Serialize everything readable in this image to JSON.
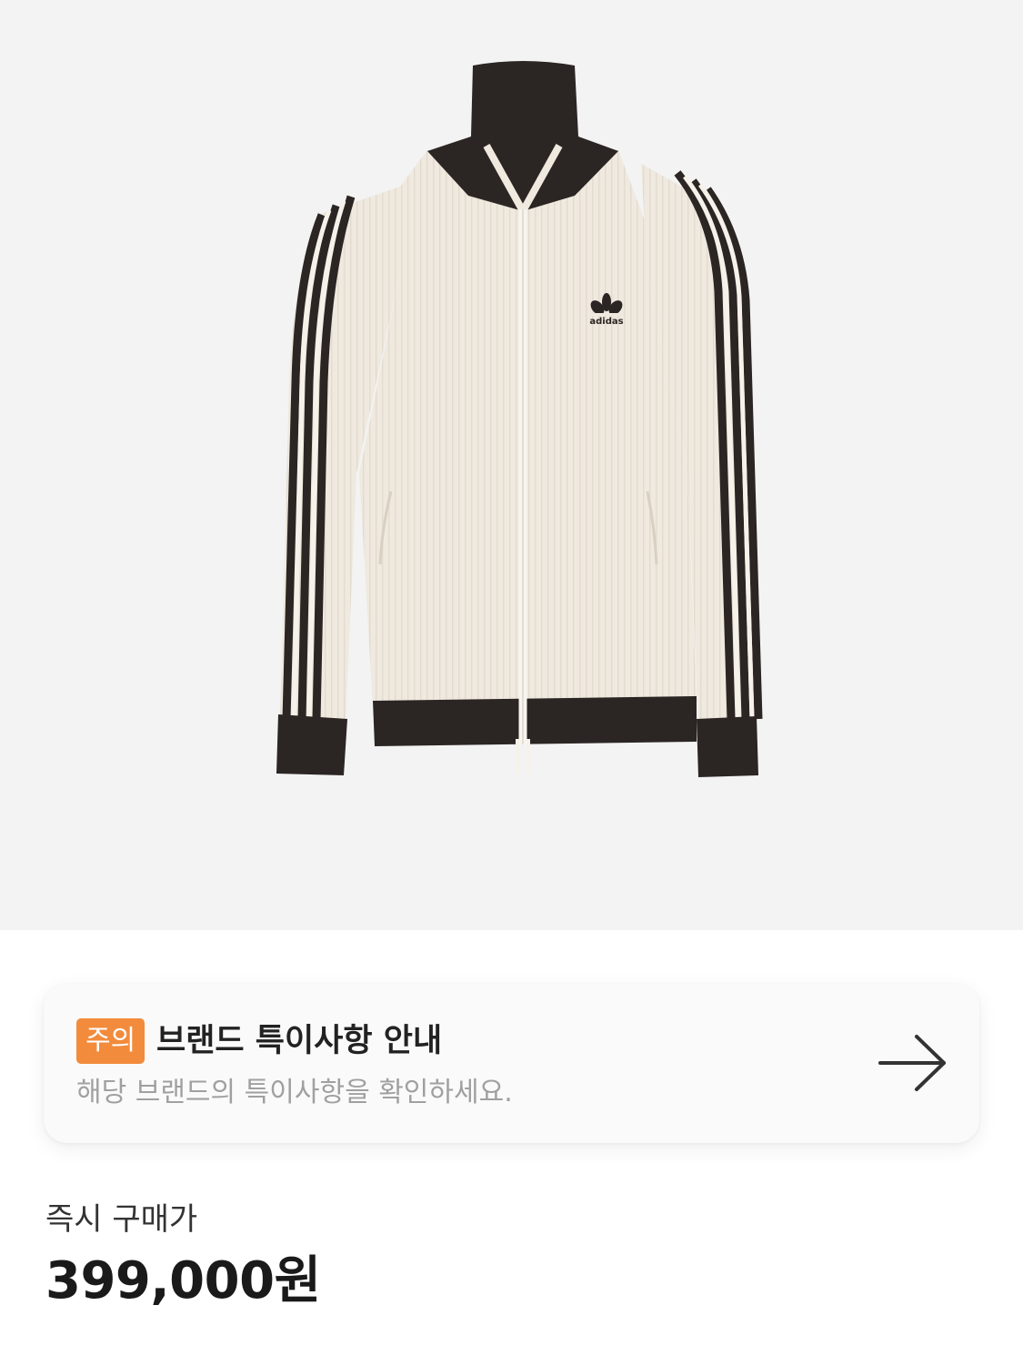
{
  "product": {
    "image_alt": "adidas track jacket",
    "logo_text": "adidas"
  },
  "notice": {
    "badge": "주의",
    "title": "브랜드 특이사항 안내",
    "subtitle": "해당 브랜드의 특이사항을 확인하세요.",
    "arrow_icon": "arrow-right-icon",
    "badge_color": "#f28b3b"
  },
  "price": {
    "label": "즉시 구매가",
    "value": "399,000원"
  }
}
